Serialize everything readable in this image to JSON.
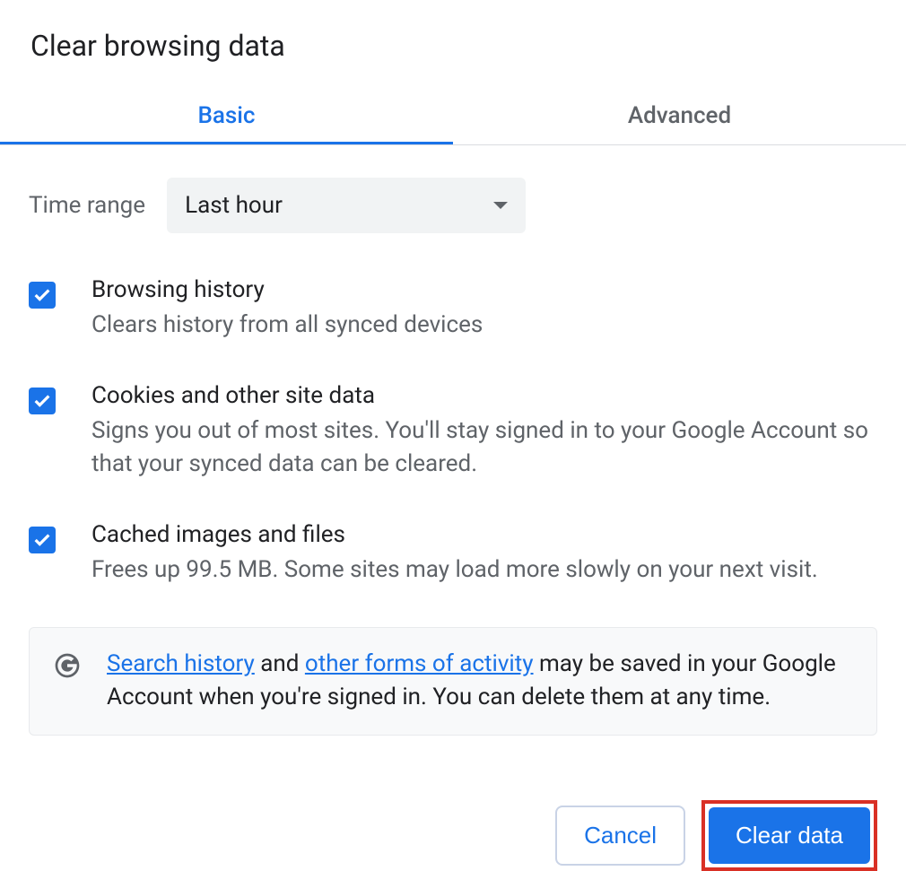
{
  "dialog": {
    "title": "Clear browsing data"
  },
  "tabs": {
    "basic": "Basic",
    "advanced": "Advanced"
  },
  "time_range": {
    "label": "Time range",
    "selected": "Last hour"
  },
  "options": {
    "browsing_history": {
      "title": "Browsing history",
      "desc": "Clears history from all synced devices",
      "checked": true
    },
    "cookies": {
      "title": "Cookies and other site data",
      "desc": "Signs you out of most sites. You'll stay signed in to your Google Account so that your synced data can be cleared.",
      "checked": true
    },
    "cache": {
      "title": "Cached images and files",
      "desc": "Frees up 99.5 MB. Some sites may load more slowly on your next visit.",
      "checked": true
    }
  },
  "info_box": {
    "link_search_history": "Search history",
    "text_and": " and ",
    "link_other_forms": "other forms of activity",
    "text_rest": " may be saved in your Google Account when you're signed in. You can delete them at any time."
  },
  "buttons": {
    "cancel": "Cancel",
    "clear_data": "Clear data"
  }
}
